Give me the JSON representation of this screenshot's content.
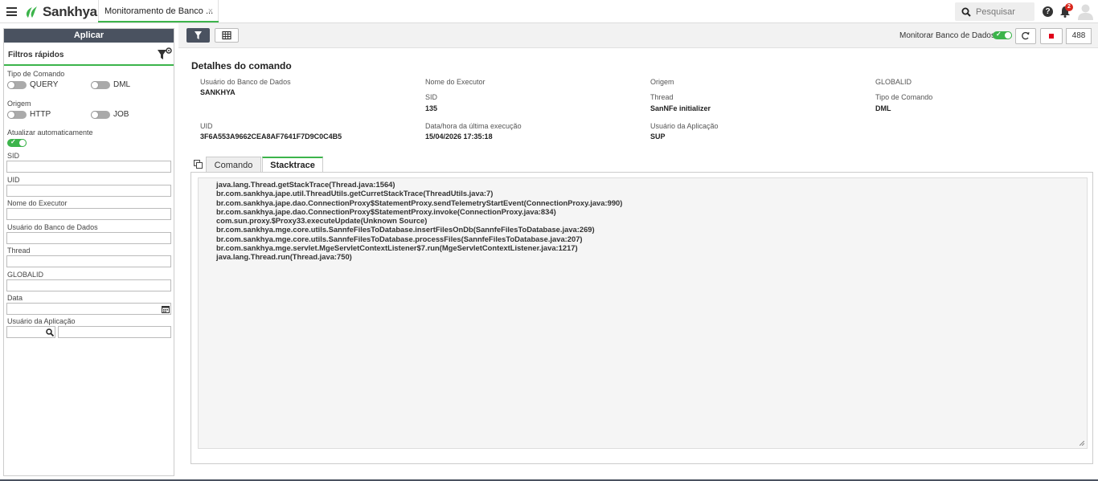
{
  "header": {
    "brand": "Sankhya",
    "tab_label": "Monitoramento de Banco ...",
    "tab_close": "×",
    "search_placeholder": "Pesquisar",
    "help": "?",
    "notification_count": "2"
  },
  "sidebar": {
    "apply_label": "Aplicar",
    "quick_filters_title": "Filtros rápidos",
    "command_type_label": "Tipo de Comando",
    "query_label": "QUERY",
    "dml_label": "DML",
    "origin_label": "Origem",
    "http_label": "HTTP",
    "job_label": "JOB",
    "auto_update_label": "Atualizar automaticamente",
    "sid_label": "SID",
    "uid_label": "UID",
    "executor_label": "Nome do Executor",
    "db_user_label": "Usuário do Banco de Dados",
    "thread_label": "Thread",
    "globalid_label": "GLOBALID",
    "date_label": "Data",
    "app_user_label": "Usuário da Aplicação"
  },
  "toolbar": {
    "monitor_label": "Monitorar Banco de Dados",
    "count": "488"
  },
  "details": {
    "title": "Detalhes do comando",
    "db_user_label": "Usuário do Banco de Dados",
    "db_user_value": "SANKHYA",
    "executor_label": "Nome do Executor",
    "sid_label": "SID",
    "sid_value": "135",
    "origin_label": "Origem",
    "thread_label": "Thread",
    "thread_value": "SanNFe initializer",
    "globalid_label": "GLOBALID",
    "command_type_label": "Tipo de Comando",
    "command_type_value": "DML",
    "uid_label": "UID",
    "uid_value": "3F6A553A9662CEA8AF7641F7D9C0C4B5",
    "last_exec_label": "Data/hora da última execução",
    "last_exec_value": "15/04/2026 17:35:18",
    "app_user_label": "Usuário da Aplicação",
    "app_user_value": "SUP"
  },
  "tabs": {
    "command": "Comando",
    "stacktrace": "Stacktrace"
  },
  "stacktrace": [
    "java.lang.Thread.getStackTrace(Thread.java:1564)",
    "br.com.sankhya.jape.util.ThreadUtils.getCurretStackTrace(ThreadUtils.java:7)",
    "br.com.sankhya.jape.dao.ConnectionProxy$StatementProxy.sendTelemetryStartEvent(ConnectionProxy.java:990)",
    "br.com.sankhya.jape.dao.ConnectionProxy$StatementProxy.invoke(ConnectionProxy.java:834)",
    "com.sun.proxy.$Proxy33.executeUpdate(Unknown Source)",
    "br.com.sankhya.mge.core.utils.SannfeFilesToDatabase.insertFilesOnDb(SannfeFilesToDatabase.java:269)",
    "br.com.sankhya.mge.core.utils.SannfeFilesToDatabase.processFiles(SannfeFilesToDatabase.java:207)",
    "br.com.sankhya.mge.servlet.MgeServletContextListener$7.run(MgeServletContextListener.java:1217)",
    "java.lang.Thread.run(Thread.java:750)"
  ],
  "colors": {
    "accent": "#3cb44b",
    "dark": "#4a5260",
    "stop": "#e0001a"
  }
}
